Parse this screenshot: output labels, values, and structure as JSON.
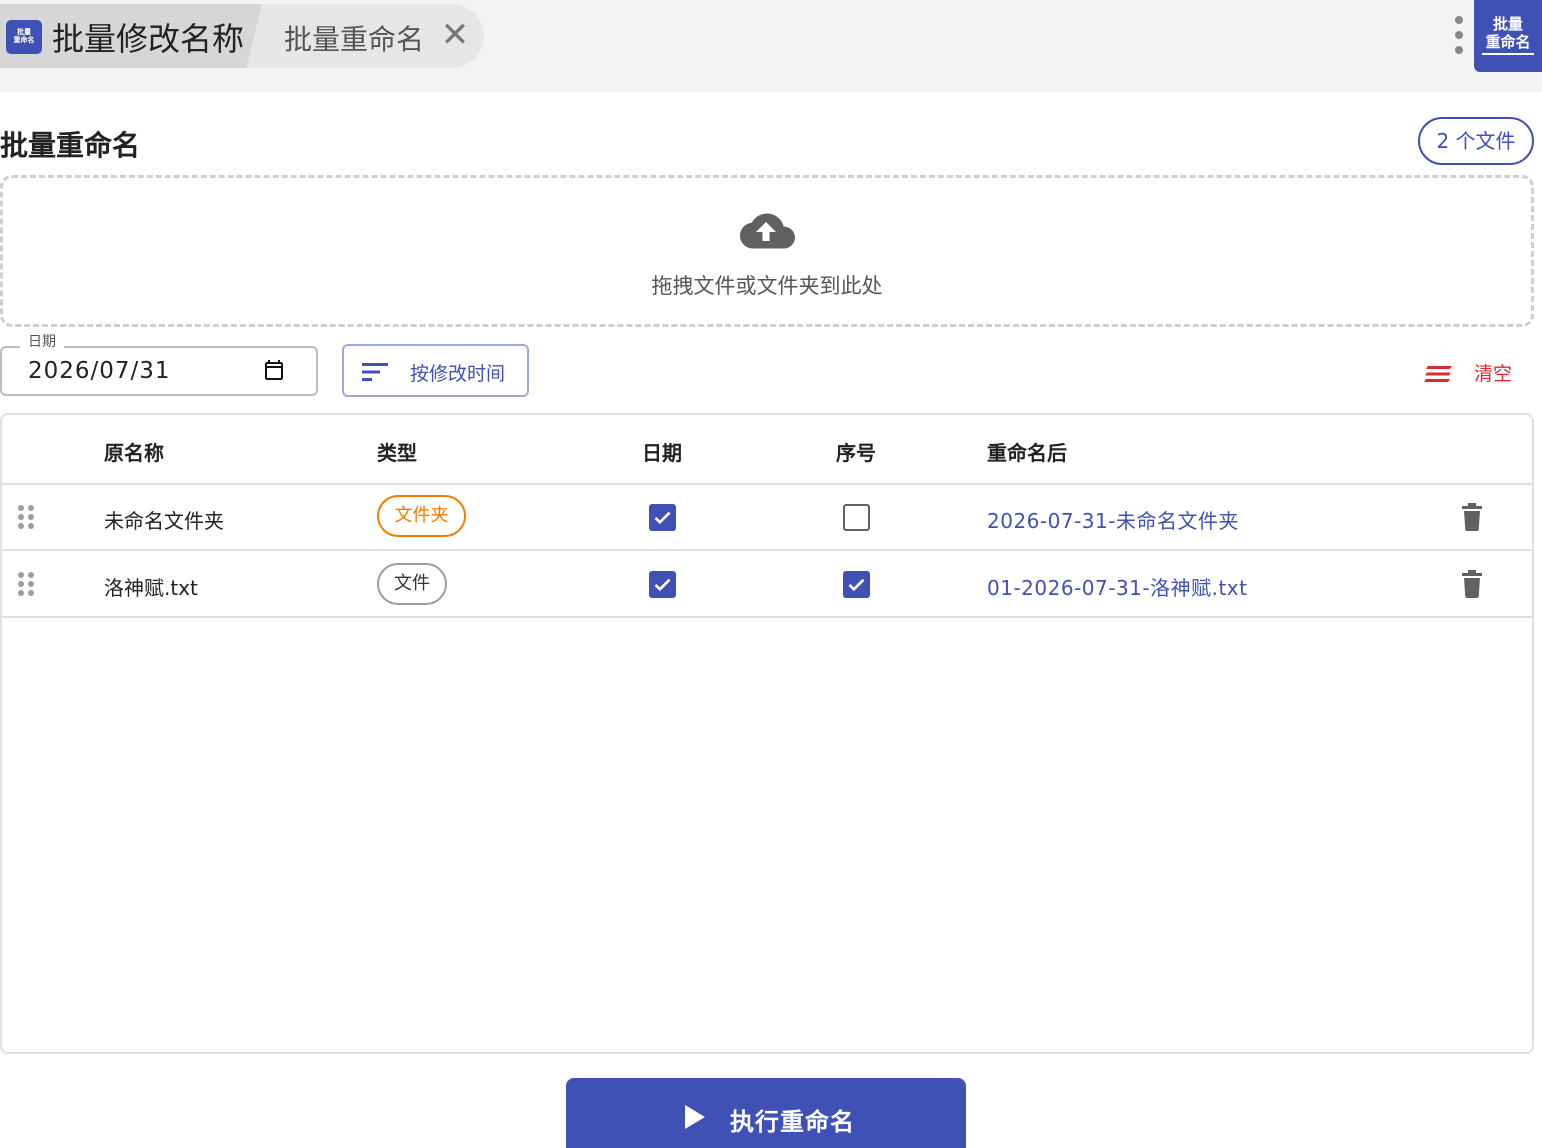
{
  "tabs": {
    "active_title": "批量修改名称",
    "second_title": "批量重命名",
    "close_glyph": "✕",
    "app_icon_text": "批量重命名",
    "corner_badge_line1": "批量",
    "corner_badge_line2": "重命名"
  },
  "header": {
    "title": "批量重命名",
    "file_count": "2 个文件"
  },
  "dropzone": {
    "icon": "cloud-upload-icon",
    "text": "拖拽文件或文件夹到此处"
  },
  "toolbar": {
    "date_label": "日期",
    "date_value": "2026/07/31",
    "sort_label": "按修改时间",
    "clear_label": "清空"
  },
  "table": {
    "headers": [
      "原名称",
      "类型",
      "日期",
      "序号",
      "重命名后"
    ],
    "rows": [
      {
        "name": "未命名文件夹",
        "type": "文件夹",
        "date_checked": true,
        "seq_checked": false,
        "new_name": "2026-07-31-未命名文件夹"
      },
      {
        "name": "洛神赋.txt",
        "type": "文件",
        "date_checked": true,
        "seq_checked": true,
        "new_name": "01-2026-07-31-洛神赋.txt"
      }
    ]
  },
  "actions": {
    "execute_label": "执行重命名"
  },
  "colors": {
    "primary": "#3f51b5",
    "folder_chip": "#f57c00",
    "danger": "#d32f2f"
  }
}
